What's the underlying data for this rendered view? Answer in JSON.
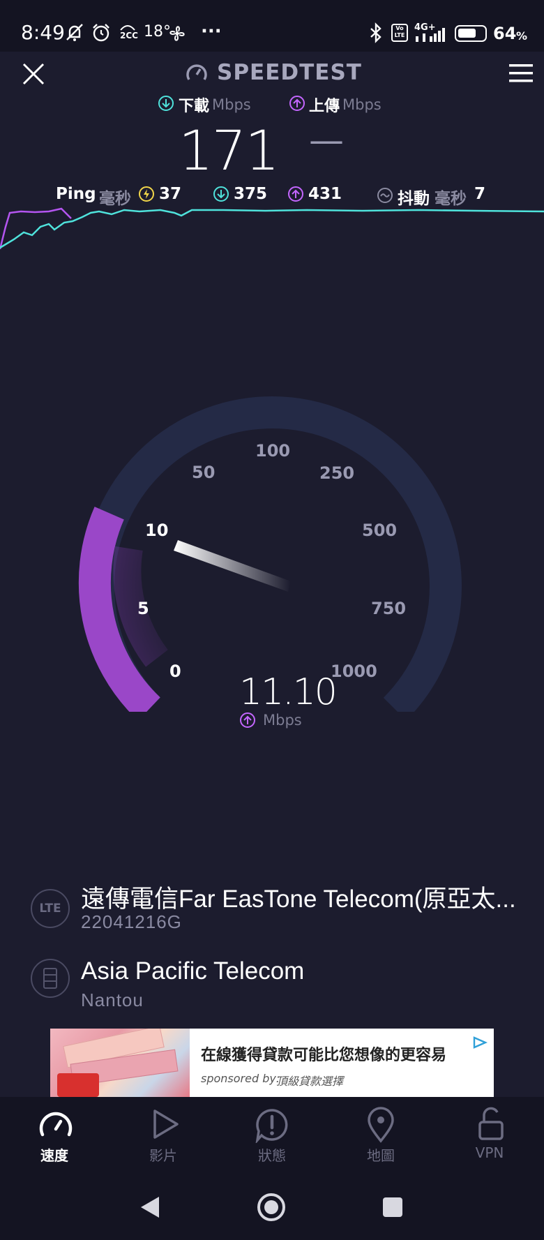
{
  "status_bar": {
    "time": "8:49",
    "temp": "18°",
    "more": "···",
    "battery": "64",
    "battery_unit": "%",
    "aqi_badge": "2CC",
    "net_badge": "4G+",
    "volte_badge": "Vo LTE"
  },
  "header": {
    "title": "SPEEDTEST",
    "accent": "#4fe3dc",
    "upload_accent": "#c466ff"
  },
  "metrics": {
    "download_label": "下載",
    "upload_label": "上傳",
    "unit": "Mbps",
    "download_value": "171",
    "upload_value": "—"
  },
  "ping": {
    "label": "Ping",
    "unit": "毫秒",
    "idle": "37",
    "download": "375",
    "upload": "431",
    "jitter_label": "抖動",
    "jitter_unit": "毫秒",
    "jitter": "7"
  },
  "gauge": {
    "ticks": [
      "0",
      "5",
      "10",
      "50",
      "100",
      "250",
      "500",
      "750",
      "1000"
    ],
    "value": "11.10",
    "unit": "Mbps",
    "needle_value": 11.1
  },
  "provider": {
    "icon": "LTE",
    "name": "遠傳電信Far EasTone Telecom(原亞太...",
    "device": "22041216G"
  },
  "server": {
    "name": "Asia Pacific Telecom",
    "location": "Nantou"
  },
  "ad": {
    "headline": "在線獲得貸款可能比您想像的更容易",
    "sponsor_prefix": "sponsored by:",
    "sponsor_name": "頂級貸款選擇"
  },
  "nav": {
    "items": [
      {
        "label": "速度",
        "icon": "speed-icon",
        "active": true
      },
      {
        "label": "影片",
        "icon": "play-icon",
        "active": false
      },
      {
        "label": "狀態",
        "icon": "alert-icon",
        "active": false
      },
      {
        "label": "地圖",
        "icon": "map-pin-icon",
        "active": false
      },
      {
        "label": "VPN",
        "icon": "lock-icon",
        "active": false
      }
    ]
  }
}
